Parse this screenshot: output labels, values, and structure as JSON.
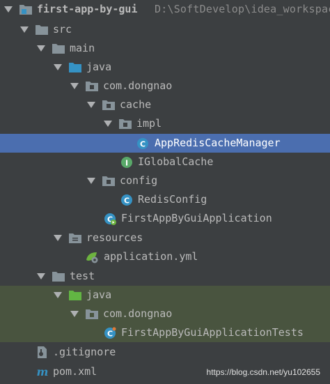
{
  "tree": {
    "project": {
      "label": "first-app-by-gui",
      "path": "D:\\SoftDevelop\\idea_workspace"
    },
    "src": "src",
    "main": "main",
    "java_main": "java",
    "pkg_main": "com.dongnao",
    "cache": "cache",
    "impl": "impl",
    "app_redis_cache_manager": "AppRedisCacheManager",
    "iglobal_cache": "IGlobalCache",
    "config": "config",
    "redis_config": "RedisConfig",
    "app_main_class": "FirstAppByGuiApplication",
    "resources": "resources",
    "application_yml": "application.yml",
    "test": "test",
    "java_test": "java",
    "pkg_test": "com.dongnao",
    "app_tests_class": "FirstAppByGuiApplicationTests",
    "gitignore": ".gitignore",
    "pom": "pom.xml"
  },
  "watermark": "https://blog.csdn.net/yu102655",
  "colors": {
    "background": "#3c3f41",
    "selection": "#4b6eaf",
    "test_highlight": "#49543f",
    "folder": "#87939a",
    "source_folder": "#3592c4",
    "test_folder": "#62b543",
    "class_icon": "#3592c4",
    "interface_icon": "#59a869"
  },
  "icons": {
    "project": "project-folder-icon",
    "folder": "folder-icon",
    "source_folder": "source-folder-icon",
    "test_folder": "test-folder-icon",
    "resources_folder": "resources-folder-icon",
    "package": "package-icon",
    "class": "class-icon",
    "interface": "interface-icon",
    "spring_boot_class": "spring-boot-class-icon",
    "spring_yaml": "spring-yaml-icon",
    "gitignore": "gitignore-file-icon",
    "maven": "maven-icon"
  }
}
